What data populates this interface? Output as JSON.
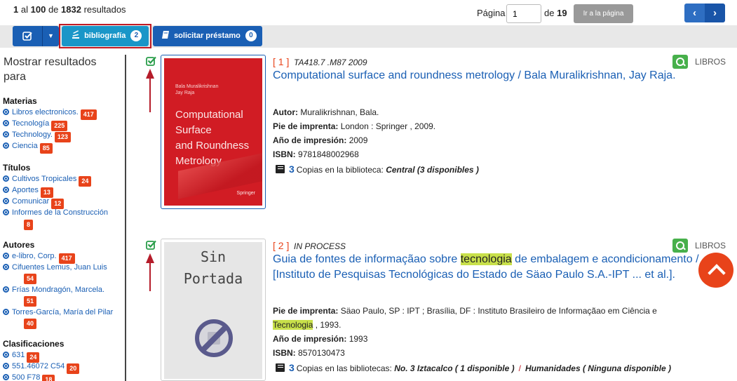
{
  "results": {
    "from": "1",
    "al": "al",
    "to": "100",
    "de": "de",
    "total": "1832",
    "label": "resultados"
  },
  "pager": {
    "label": "Página",
    "current": "1",
    "de": "de",
    "total": "19",
    "goto_label": "Ir a la página",
    "prev_glyph": "‹",
    "next_glyph": "›"
  },
  "toolbar": {
    "bibliografia_label": "bibliografía",
    "bibliografia_count": "2",
    "prestamo_label": "solicitar préstamo",
    "prestamo_count": "0"
  },
  "sidebar": {
    "title": "Mostrar resultados para",
    "groups": [
      {
        "heading": "Materias",
        "items": [
          {
            "label": "Libros electronicos.",
            "count": "417"
          },
          {
            "label": "Tecnología",
            "count": "225"
          },
          {
            "label": "Technology.",
            "count": "123"
          },
          {
            "label": "Ciencia",
            "count": "85"
          }
        ]
      },
      {
        "heading": "Títulos",
        "items": [
          {
            "label": "Cultivos Tropicales",
            "count": "24"
          },
          {
            "label": "Aportes",
            "count": "13"
          },
          {
            "label": "Comunicar",
            "count": "12"
          },
          {
            "label": "Informes de la Construcción",
            "count": "8"
          }
        ]
      },
      {
        "heading": "Autores",
        "items": [
          {
            "label": "e-libro, Corp.",
            "count": "417"
          },
          {
            "label": "Cifuentes Lemus, Juan Luis",
            "count": "54"
          },
          {
            "label": "Frías Mondragón, Marcela.",
            "count": "51"
          },
          {
            "label": "Torres-García, María del Pilar",
            "count": "40"
          }
        ]
      },
      {
        "heading": "Clasificaciones",
        "items": [
          {
            "label": "631",
            "count": "24"
          },
          {
            "label": "551.46072 C54",
            "count": "20"
          },
          {
            "label": "500 F78",
            "count": "18"
          }
        ]
      }
    ]
  },
  "records": [
    {
      "num": "[ 1 ]",
      "call": "TA418.7 .M87 2009",
      "title": "Computational surface and roundness metrology / Bala Muralikrishnan, Jay Raja.",
      "type": "LIBROS",
      "cover": {
        "authors": [
          "Bala Muralikrishnan",
          "Jay Raja"
        ],
        "title_lines": [
          "Computational",
          "Surface",
          "and Roundness",
          "Metrology"
        ],
        "publisher": "Springer"
      },
      "fields": [
        {
          "label": "Autor:",
          "value": "Muralikrishnan, Bala."
        },
        {
          "label": "Pie de imprenta:",
          "value": "London : Springer , 2009."
        },
        {
          "label": "Año de impresión:",
          "value": "2009"
        },
        {
          "label": "ISBN:",
          "value": "9781848002968"
        }
      ],
      "copies": {
        "count": "3",
        "text": "Copias en la biblioteca:",
        "library1": "Central (3 disponibles )"
      }
    },
    {
      "num": "[ 2 ]",
      "call": "IN PROCESS",
      "title_before": "Guia de fontes de informaçãao sobre ",
      "title_highlight": "tecnologia",
      "title_after": " de embalagem e acondicionamento / [Instituto de Pesquisas Tecnológicas do Estado de Säao Paulo S.A.-IPT ... et al.].",
      "type": "LIBROS",
      "cover": {
        "line1": "Sin",
        "line2": "Portada"
      },
      "imprenta_label": "Pie de imprenta:",
      "imprenta_value": "Säao Paulo, SP : IPT ; Brasília, DF : Instituto Brasileiro de Informaçãao em Ciência e",
      "imprenta_highlight": "Tecnologia",
      "imprenta_after": ", 1993.",
      "fields": [
        {
          "label": "Año de impresión:",
          "value": "1993"
        },
        {
          "label": "ISBN:",
          "value": "8570130473"
        }
      ],
      "copies": {
        "count": "3",
        "text": "Copias en las bibliotecas:",
        "library1": "No. 3 Iztacalco ( 1 disponible )",
        "sep": "/",
        "library2": "Humanidades ( Ninguna disponible )"
      }
    }
  ],
  "colors": {
    "primary": "#1a5fb4",
    "accent": "#e8431a",
    "highlight": "#c8e04a",
    "marker": "#b51c2a",
    "check": "#2a9d4a"
  },
  "icons": [
    "check-square-icon",
    "caret-down-icon",
    "bibliography-icon",
    "book-icon",
    "zoom-icon",
    "chevron-left-icon",
    "chevron-right-icon",
    "chevron-up-icon",
    "radio-dot-icon",
    "no-cover-icon"
  ]
}
